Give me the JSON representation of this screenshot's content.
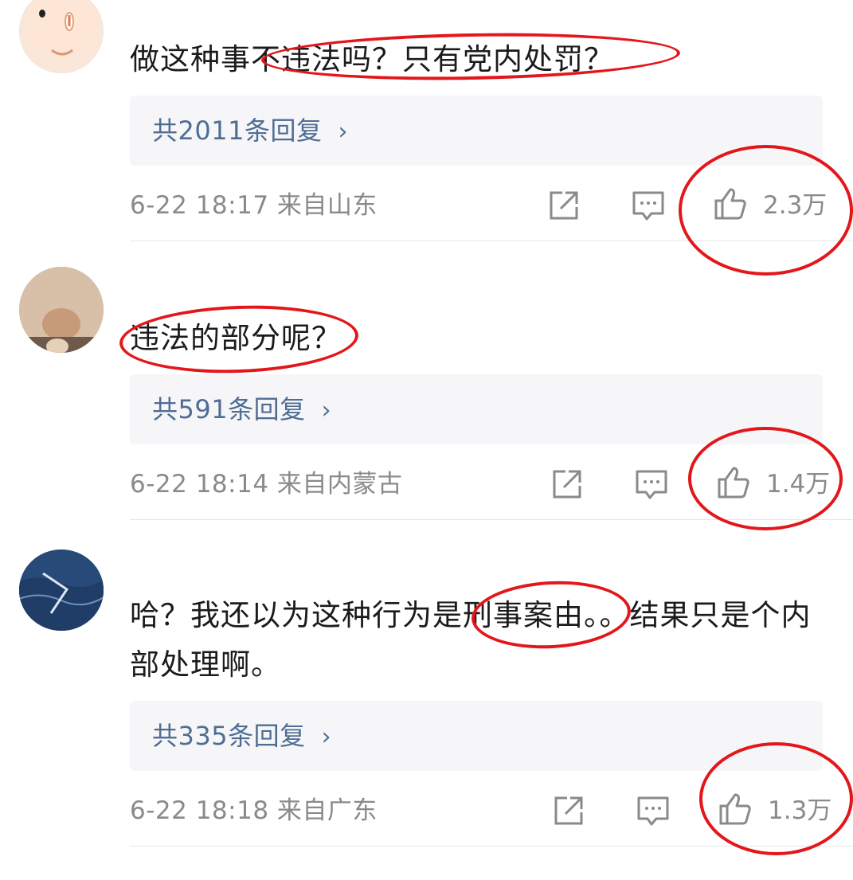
{
  "comments": [
    {
      "text": "做这种事不违法吗？只有党内处罚？",
      "replies_label": "共2011条回复",
      "meta": "6-22 18:17 来自山东",
      "likes": "2.3万"
    },
    {
      "text": "违法的部分呢？",
      "replies_label": "共591条回复",
      "meta": "6-22 18:14 来自内蒙古",
      "likes": "1.4万"
    },
    {
      "text": "哈？我还以为这种行为是刑事案由。。结果只是个内部处理啊。",
      "replies_label": "共335条回复",
      "meta": "6-22 18:18 来自广东",
      "likes": "1.3万"
    }
  ],
  "chevron": "›",
  "icons": {
    "share": "share-icon",
    "comment": "comment-icon",
    "like": "thumbs-up-icon"
  },
  "colors": {
    "link": "#4f6d94",
    "meta": "#8a8a8a",
    "annotation": "#e3171b",
    "reply_bg": "#f6f6f8"
  }
}
